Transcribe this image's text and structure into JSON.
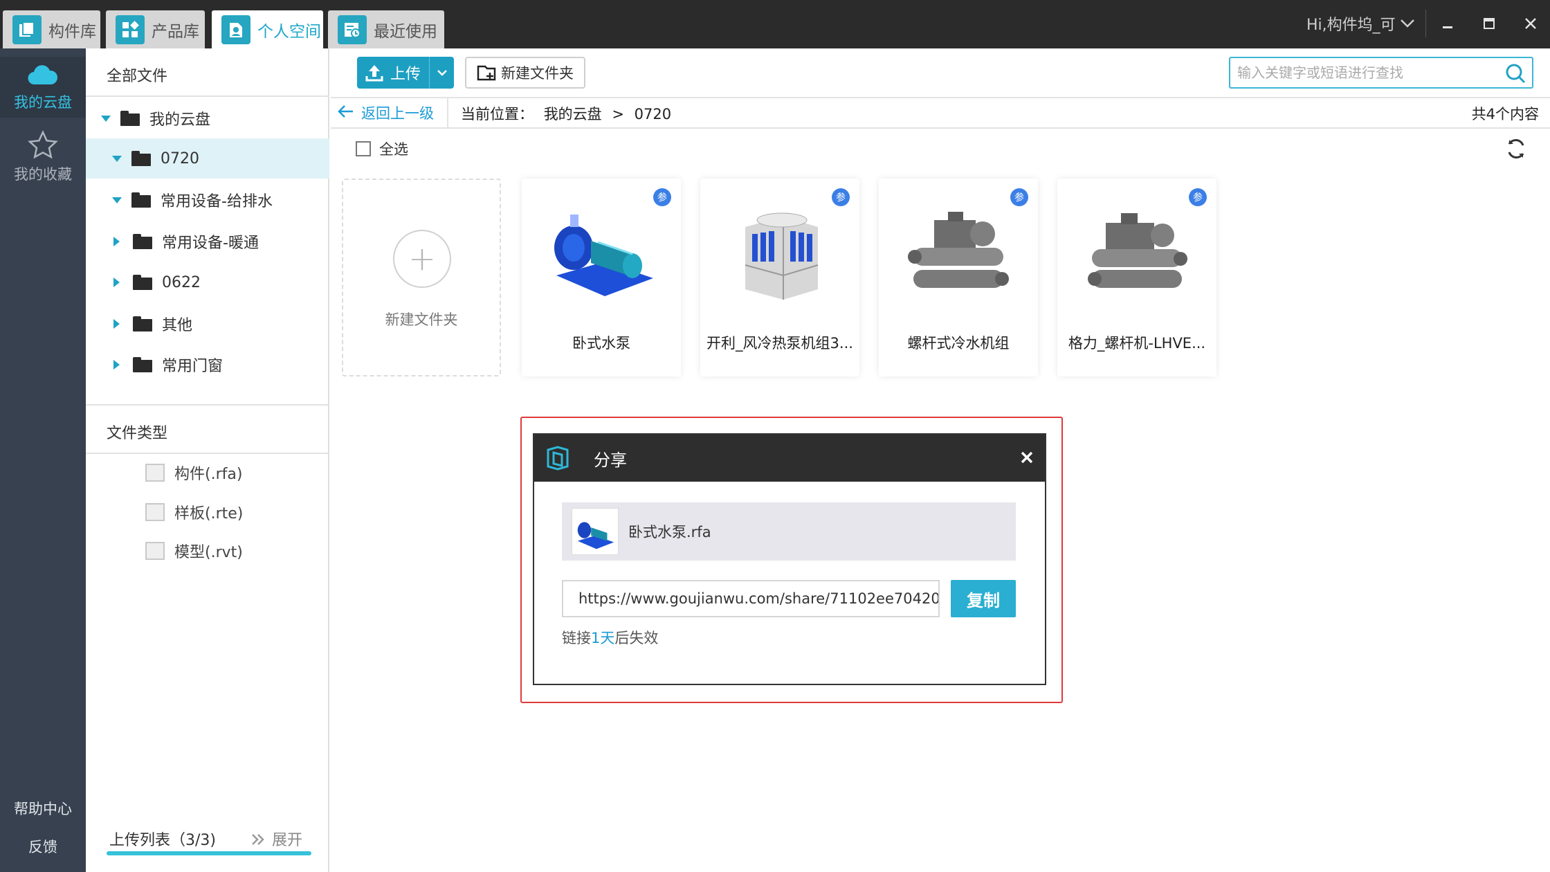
{
  "tabs": [
    {
      "label": "构件库",
      "icon": "component-library-icon"
    },
    {
      "label": "产品库",
      "icon": "product-library-icon"
    },
    {
      "label": "个人空间",
      "icon": "personal-space-icon"
    },
    {
      "label": "最近使用",
      "icon": "recent-icon"
    }
  ],
  "active_tab": "个人空间",
  "user": {
    "greeting": "Hi,构件坞_可"
  },
  "rail": {
    "cloud_label": "我的云盘",
    "favorites_label": "我的收藏",
    "help_label": "帮助中心",
    "feedback_label": "反馈"
  },
  "tree": {
    "all_files_label": "全部文件",
    "root": "我的云盘",
    "folders": [
      {
        "label": "0720",
        "expanded": true,
        "selected": true
      },
      {
        "label": "常用设备-给排水",
        "expanded": true
      },
      {
        "label": "常用设备-暖通",
        "expanded": false
      },
      {
        "label": "0622",
        "expanded": false
      },
      {
        "label": "其他",
        "expanded": false
      },
      {
        "label": "常用门窗",
        "expanded": false
      }
    ],
    "file_types_label": "文件类型",
    "file_types": [
      {
        "label": "构件(.rfa)"
      },
      {
        "label": "样板(.rte)"
      },
      {
        "label": "模型(.rvt)"
      }
    ],
    "upload_list_label": "上传列表（3/3)",
    "expand_label": "展开"
  },
  "toolbar": {
    "upload_label": "上传",
    "new_folder_label": "新建文件夹",
    "search_placeholder": "输入关键字或短语进行查找"
  },
  "breadcrumb": {
    "back_label": "返回上一级",
    "location_label": "当前位置：",
    "path": [
      "我的云盘",
      ">",
      "0720"
    ],
    "count_label": "共4个内容"
  },
  "select_all_label": "全选",
  "new_folder_card_label": "新建文件夹",
  "files": [
    {
      "name": "卧式水泵",
      "badge": "参"
    },
    {
      "name": "开利_风冷热泵机组3...",
      "badge": "参"
    },
    {
      "name": "螺杆式冷水机组",
      "badge": "参"
    },
    {
      "name": "格力_螺杆机-LHVE...",
      "badge": "参"
    }
  ],
  "share_dialog": {
    "title": "分享",
    "file_name": "卧式水泵.rfa",
    "link": "https://www.goujianwu.com/share/71102ee70420",
    "copy_label": "复制",
    "expire_prefix": "链接",
    "expire_value": "1天",
    "expire_suffix": "后失效"
  },
  "colors": {
    "accent": "#1d9fc2",
    "rail_bg": "#374150",
    "highlight_border": "#e03a3a",
    "badge": "#3b7fe6"
  }
}
